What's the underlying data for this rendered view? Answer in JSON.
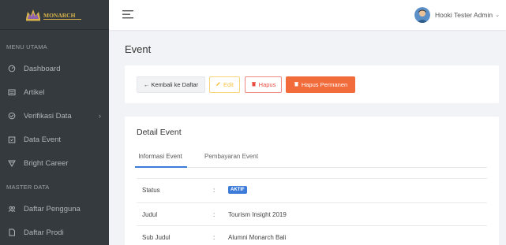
{
  "brand": {
    "name": "MONARCH"
  },
  "sidebar": {
    "sections": [
      {
        "title": "MENU UTAMA"
      },
      {
        "title": "MASTER DATA"
      }
    ],
    "items": [
      {
        "label": "Dashboard",
        "icon": "dashboard-icon"
      },
      {
        "label": "Artikel",
        "icon": "article-icon"
      },
      {
        "label": "Verifikasi Data",
        "icon": "verify-icon",
        "chevron": "›"
      },
      {
        "label": "Data Event",
        "icon": "calendar-icon"
      },
      {
        "label": "Bright Career",
        "icon": "career-icon"
      },
      {
        "label": "Daftar Pengguna",
        "icon": "users-icon"
      },
      {
        "label": "Daftar Prodi",
        "icon": "document-icon"
      }
    ]
  },
  "topbar": {
    "user_name": "Hooki Tester Admin",
    "caret": "⌄"
  },
  "page": {
    "title": "Event"
  },
  "actions": {
    "back_label": "← Kembali ke Daftar",
    "edit_label": "Edit",
    "hapus_label": "Hapus",
    "permanent_label": "Hapus Permanen"
  },
  "detail": {
    "title": "Detail Event",
    "tabs": [
      {
        "label": "Informasi Event",
        "active": true
      },
      {
        "label": "Pembayaran Event",
        "active": false
      }
    ],
    "rows": [
      {
        "label": "Status",
        "sep": ":",
        "badge": "AKTIF"
      },
      {
        "label": "Judul",
        "sep": ":",
        "value": "Tourism Insight 2019"
      },
      {
        "label": "Sub Judul",
        "sep": ":",
        "value": "Alumni Monarch Bali"
      }
    ]
  },
  "colors": {
    "sidebar_bg": "#353a3e",
    "accent_blue": "#3d7bd9",
    "danger": "#ea4b3f",
    "warning": "#f6c343",
    "orange": "#f26b3a",
    "brand_gold": "#d9b44a"
  }
}
